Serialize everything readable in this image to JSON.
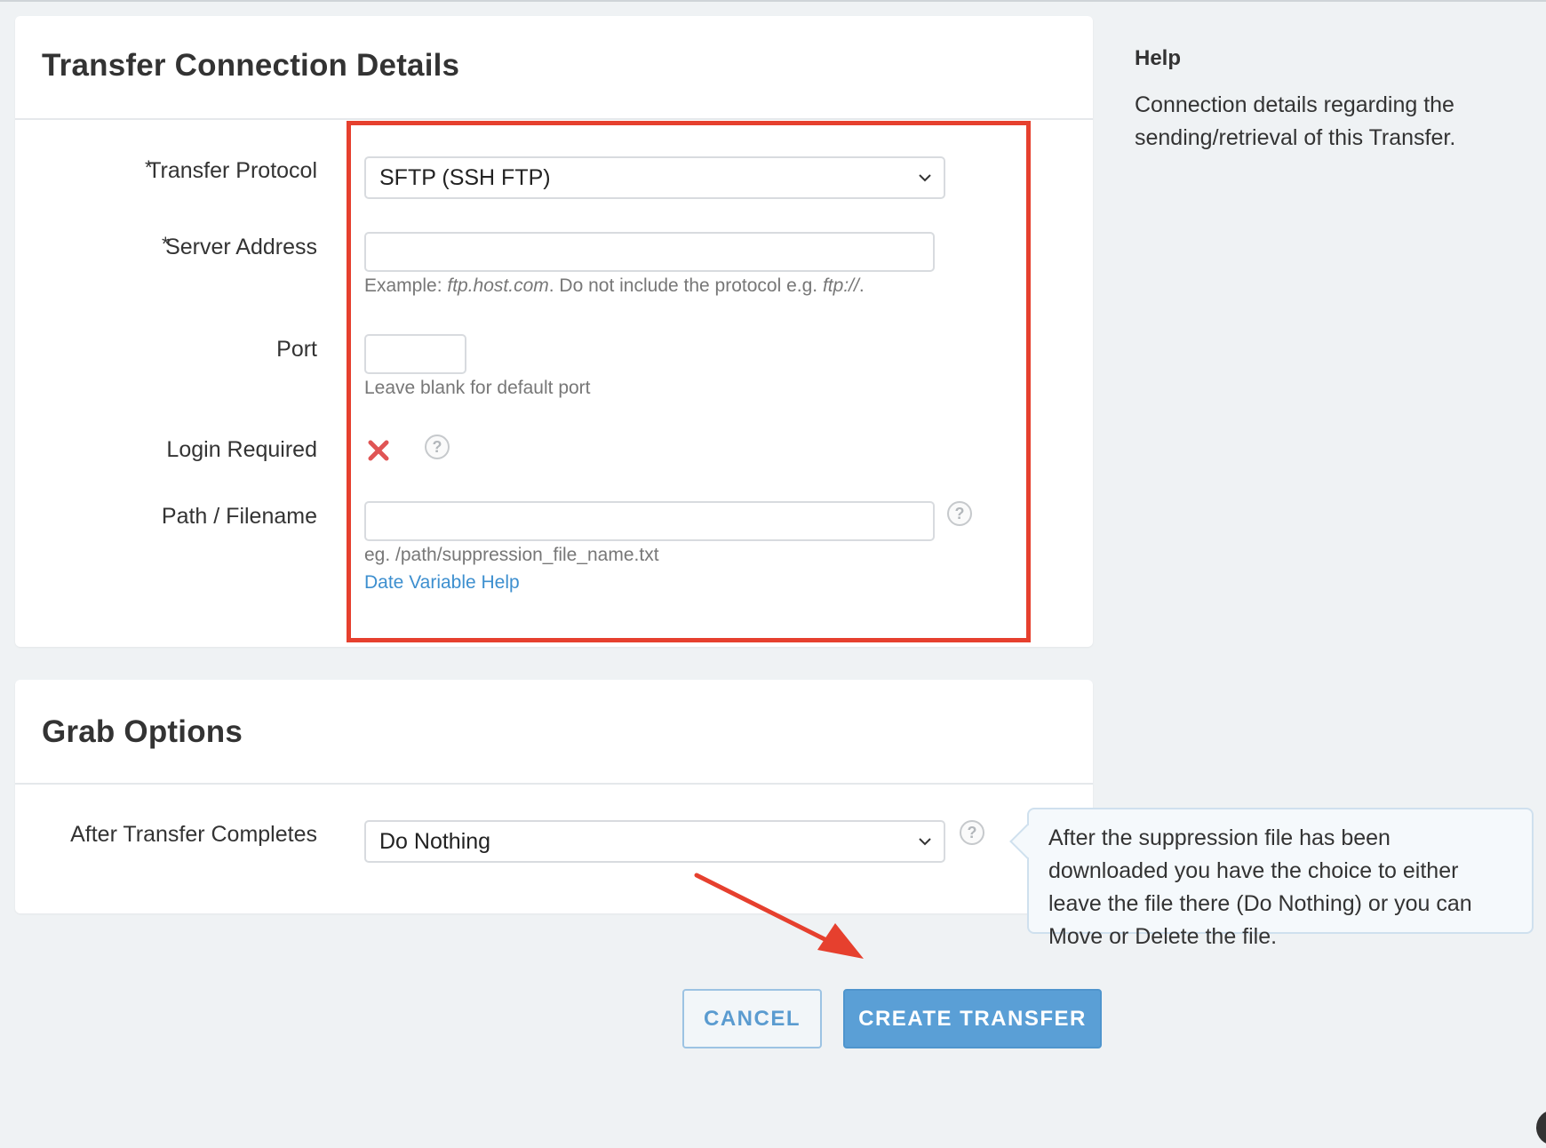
{
  "connection_panel": {
    "title": "Transfer Connection Details",
    "fields": {
      "protocol": {
        "required_mark": "*",
        "label": "Transfer Protocol",
        "value": "SFTP (SSH FTP)"
      },
      "server": {
        "required_mark": "*",
        "label": "Server Address",
        "value": "",
        "hint_prefix": "Example: ",
        "hint_example": "ftp.host.com",
        "hint_middle": ". Do not include the protocol e.g. ",
        "hint_protocol": "ftp://",
        "hint_suffix": "."
      },
      "port": {
        "label": "Port",
        "value": "",
        "hint": "Leave blank for default port"
      },
      "login": {
        "label": "Login Required",
        "value_icon": "red-x-icon",
        "help_glyph": "?"
      },
      "path": {
        "label": "Path / Filename",
        "value": "",
        "hint": "eg. /path/suppression_file_name.txt",
        "link": "Date Variable Help",
        "help_glyph": "?"
      }
    }
  },
  "grab_panel": {
    "title": "Grab Options",
    "after_transfer": {
      "label": "After Transfer Completes",
      "value": "Do Nothing",
      "help_glyph": "?"
    }
  },
  "sidebar_help": {
    "title": "Help",
    "text": "Connection details regarding the sending/retrieval of this Transfer."
  },
  "tooltip": {
    "text": "After the suppression file has been downloaded you have the choice to either leave the file there (Do Nothing) or you can Move or Delete the file."
  },
  "actions": {
    "cancel_label": "CANCEL",
    "create_label": "CREATE TRANSFER"
  },
  "colors": {
    "accent": "#5a9fd6",
    "highlight": "#e6402e",
    "link": "#3d8fcf"
  }
}
